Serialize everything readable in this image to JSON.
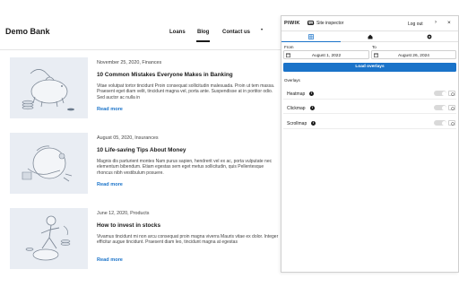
{
  "site": {
    "brand": "Demo Bank",
    "nav": [
      {
        "label": "Loans",
        "active": false
      },
      {
        "label": "Blog",
        "active": true
      },
      {
        "label": "Contact us",
        "active": false
      }
    ],
    "nav_more": "•"
  },
  "articles": [
    {
      "meta": "November 25, 2020, Finances",
      "title": "10 Common Mistakes Everyone Makes in Banking",
      "excerpt": "Vitae volutpat tortor tincidunt Proin consequat sollicitudin malesuada. Proin ut tem massa. Praesent eget diam velit, tincidunt magna vel, porta ante. Suspendisse at in portitor odio. Sed auctor ac nulla in",
      "read_more": "Read more",
      "illustration": "piggy-bank-icon"
    },
    {
      "meta": "August 05, 2020, Insurances",
      "title": "10 Life-saving Tips About Money",
      "excerpt": "Magnis dis parturient montes Nam purus sapien, hendrerit vel ex ac, porta vulputate nec elementum bibendum. Etiam egestas sem eget metus sollicitudin, quis Pellentesque rhoncus nibh vestibulum posuere.",
      "read_more": "Read more",
      "illustration": "hand-with-jar-icon"
    },
    {
      "meta": "June 12, 2020, Products",
      "title": "How to invest in stocks",
      "excerpt": "Vivamus tincidunt mi non arcu consequat proin magna viverra Mauris vitae ex dolor. Integer efficitur augue tincidunt. Praesent diam leo, tincidunt magna at egestas",
      "read_more": "Read more",
      "illustration": "person-with-coins-icon"
    }
  ],
  "inspector": {
    "logo": "PIWIK",
    "badge": "PRO",
    "title": "Site inspector",
    "logout": "Log out",
    "collapse_icon": "chevron-right-icon",
    "close": "×",
    "tabs": [
      {
        "icon": "heatmap-tab-icon",
        "active": true
      },
      {
        "icon": "home-tab-icon",
        "active": false
      },
      {
        "icon": "settings-tab-icon",
        "active": false
      }
    ],
    "from_label": "From",
    "to_label": "To",
    "from_date": "August 1, 2022",
    "to_date": "August 26, 2024",
    "load_button": "Load overlays",
    "overlays_label": "Overlays",
    "overlays": [
      {
        "name": "Heatmap",
        "enabled": false
      },
      {
        "name": "Clickmap",
        "enabled": false
      },
      {
        "name": "Scrollmap",
        "enabled": false
      }
    ],
    "colors": {
      "accent": "#1a73c9"
    }
  }
}
